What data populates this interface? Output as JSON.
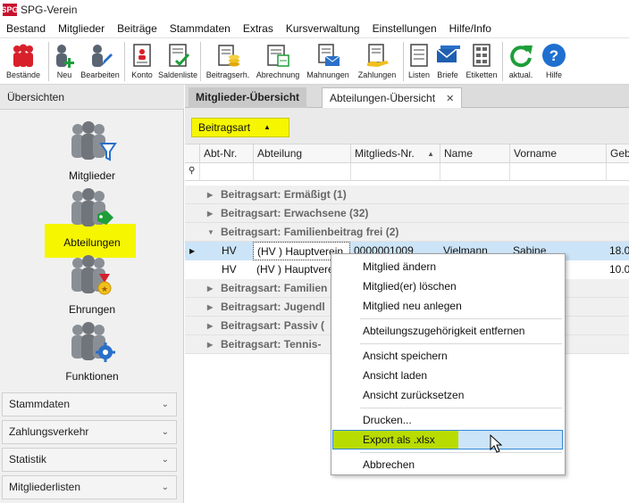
{
  "app": {
    "title": "SPG-Verein",
    "logo": "SPG"
  },
  "menu": [
    "Bestand",
    "Mitglieder",
    "Beiträge",
    "Stammdaten",
    "Extras",
    "Kursverwaltung",
    "Einstellungen",
    "Hilfe/Info"
  ],
  "toolbar": {
    "bestaende": "Bestände",
    "neu": "Neu",
    "bearbeiten": "Bearbeiten",
    "konto": "Konto",
    "saldenliste": "Saldenliste",
    "beitragserh": "Beitragserh.",
    "abrechnung": "Abrechnung",
    "mahnungen": "Mahnungen",
    "zahlungen": "Zahlungen",
    "listen": "Listen",
    "briefe": "Briefe",
    "etiketten": "Etiketten",
    "aktual": "aktual.",
    "hilfe": "Hilfe"
  },
  "sidebar": {
    "header": "Übersichten",
    "items": [
      "Mitglieder",
      "Abteilungen",
      "Ehrungen",
      "Funktionen"
    ],
    "accordion": [
      "Stammdaten",
      "Zahlungsverkehr",
      "Statistik",
      "Mitgliederlisten"
    ]
  },
  "tabs": {
    "tab1": "Mitglieder-Übersicht",
    "tab2": "Abteilungen-Übersicht",
    "close": "✕"
  },
  "grid": {
    "group_chip": "Beitragsart",
    "columns": [
      "Abt-Nr.",
      "Abteilung",
      "Mitglieds-Nr.",
      "Name",
      "Vorname",
      "Geb"
    ],
    "groups_top": [
      "Beitragsart: Ermäßigt (1)",
      "Beitragsart: Erwachsene (32)",
      "Beitragsart: Familienbeitrag frei (2)"
    ],
    "rows": [
      {
        "abt": "HV",
        "abteilung": "(HV ) Hauptverein",
        "nr": "0000001009",
        "name": "Vielmann",
        "vorname": "Sabine",
        "geb": "18.0"
      },
      {
        "abt": "HV",
        "abteilung": "(HV ) Hauptverein",
        "nr": "",
        "name": "",
        "vorname": "",
        "geb": "10.0"
      }
    ],
    "groups_bottom": [
      "Beitragsart: Familien",
      "Beitragsart: Jugendl",
      "Beitragsart: Passiv (",
      "Beitragsart: Tennis-"
    ]
  },
  "context_menu": {
    "aendern": "Mitglied ändern",
    "loeschen": "Mitglied(er) löschen",
    "neu": "Mitglied neu anlegen",
    "entfernen": "Abteilungszugehörigkeit entfernen",
    "speichern": "Ansicht speichern",
    "laden": "Ansicht laden",
    "zuruecksetzen": "Ansicht zurücksetzen",
    "drucken": "Drucken...",
    "export": "Export als .xlsx",
    "abbrechen": "Abbrechen"
  },
  "colors": {
    "highlight_yellow": "#f6f600",
    "export_green": "#b8dc00",
    "selection_blue": "#cce4f7",
    "brand_red": "#c8102e"
  }
}
